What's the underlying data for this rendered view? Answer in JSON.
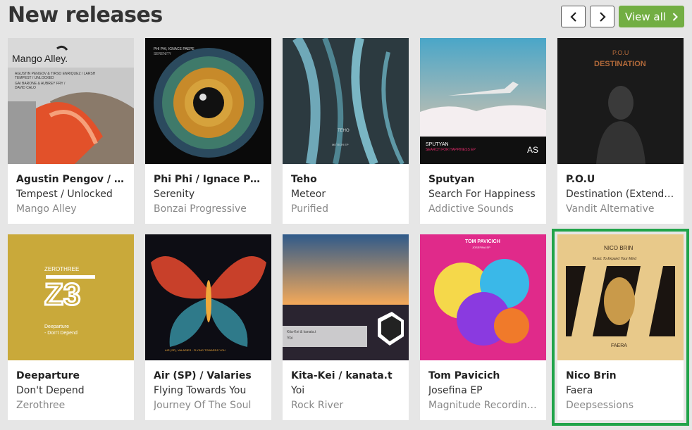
{
  "header": {
    "title": "New releases",
    "view_all_label": "View all",
    "prev_icon": "chevron-left-icon",
    "next_icon": "chevron-right-icon"
  },
  "colors": {
    "accent": "#72ae43",
    "selection": "#21a44a"
  },
  "releases": [
    {
      "artist": "Agustin Pengov / Tirso Enriquez / Larsh",
      "title": "Tempest / Unlocked",
      "label": "Mango Alley",
      "cover_text": "Mango Alley.",
      "cover_lines": [
        "AGUSTIN PENGOV & TIRSO ENRIQUEZ / LARSH",
        "TEMPEST / UNLOCKED",
        "GAI BARONE & AUBREY FRY /",
        "DAVID CALO"
      ]
    },
    {
      "artist": "Phi Phi / Ignace Paepe",
      "title": "Serenity",
      "label": "Bonzai Progressive",
      "cover_text": "PHI PHI, IGNACE PAEPE",
      "cover_sub": "SERENITY"
    },
    {
      "artist": "Teho",
      "title": "Meteor",
      "label": "Purified",
      "cover_text": "TEHO",
      "cover_sub": "METEOR EP"
    },
    {
      "artist": "Sputyan",
      "title": "Search For Happiness",
      "label": "Addictive Sounds",
      "cover_text": "SPUTYAN",
      "cover_sub": "SEARCH FOR HAPPINESS EP"
    },
    {
      "artist": "P.O.U",
      "title": "Destination (Extended)",
      "label": "Vandit Alternative",
      "cover_text": "P.O.U",
      "cover_sub": "DESTINATION"
    },
    {
      "artist": "Deeparture",
      "title": "Don't Depend",
      "label": "Zerothree",
      "cover_text": "ZEROTHREE",
      "cover_lines": [
        "Deeparture",
        "- Don't Depend"
      ]
    },
    {
      "artist": "Air (SP) / Valaries",
      "title": "Flying Towards You",
      "label": "Journey Of The Soul",
      "cover_text": "AIR (SP), VALARIES - FLYING TOWARDS YOU"
    },
    {
      "artist": "Kita-Kei / kanata.t",
      "title": "Yoi",
      "label": "Rock River",
      "cover_text": "Kita-Kei & kanata.t",
      "cover_sub": "Yoi"
    },
    {
      "artist": "Tom Pavicich",
      "title": "Josefina EP",
      "label": "Magnitude Recordings",
      "cover_text": "TOM PAVICICH",
      "cover_sub": "JOSEFINA EP"
    },
    {
      "artist": "Nico Brin",
      "title": "Faera",
      "label": "Deepsessions",
      "cover_text": "NICO BRIN",
      "cover_sub": "FAERA",
      "cover_lines": [
        "Music To Expand Your Mind"
      ]
    }
  ]
}
